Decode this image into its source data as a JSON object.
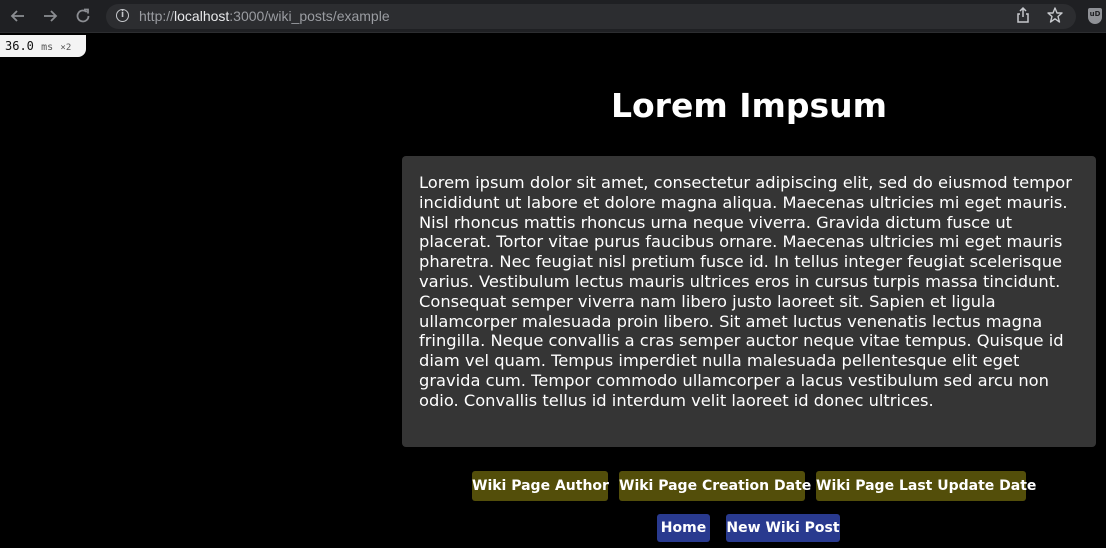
{
  "browser": {
    "url_scheme": "http://",
    "url_host": "localhost",
    "url_rest": ":3000/wiki_posts/example"
  },
  "perf_badge": {
    "value": "36.0",
    "unit": "ms",
    "multiplier": "×2"
  },
  "page": {
    "title": "Lorem Impsum",
    "body": "Lorem ipsum dolor sit amet, consectetur adipiscing elit, sed do eiusmod tempor incididunt ut labore et dolore magna aliqua. Maecenas ultricies mi eget mauris. Nisl rhoncus mattis rhoncus urna neque viverra. Gravida dictum fusce ut placerat. Tortor vitae purus faucibus ornare. Maecenas ultricies mi eget mauris pharetra. Nec feugiat nisl pretium fusce id. In tellus integer feugiat scelerisque varius. Vestibulum lectus mauris ultrices eros in cursus turpis massa tincidunt. Consequat semper viverra nam libero justo laoreet sit. Sapien et ligula ullamcorper malesuada proin libero. Sit amet luctus venenatis lectus magna fringilla. Neque convallis a cras semper auctor neque vitae tempus. Quisque id diam vel quam. Tempus imperdiet nulla malesuada pellentesque elit eget gravida cum. Tempor commodo ullamcorper a lacus vestibulum sed arcu non odio. Convallis tellus id interdum velit laoreet id donec ultrices.",
    "meta_buttons": {
      "author": "Wiki Page Author",
      "created": "Wiki Page Creation Date",
      "updated": "Wiki Page Last Update Date"
    },
    "nav_buttons": {
      "home": "Home",
      "new_post": "New Wiki Post"
    }
  },
  "colors": {
    "page_background": "#000000",
    "content_box": "#353535",
    "meta_button": "#534e0a",
    "nav_button": "#293a8f"
  }
}
